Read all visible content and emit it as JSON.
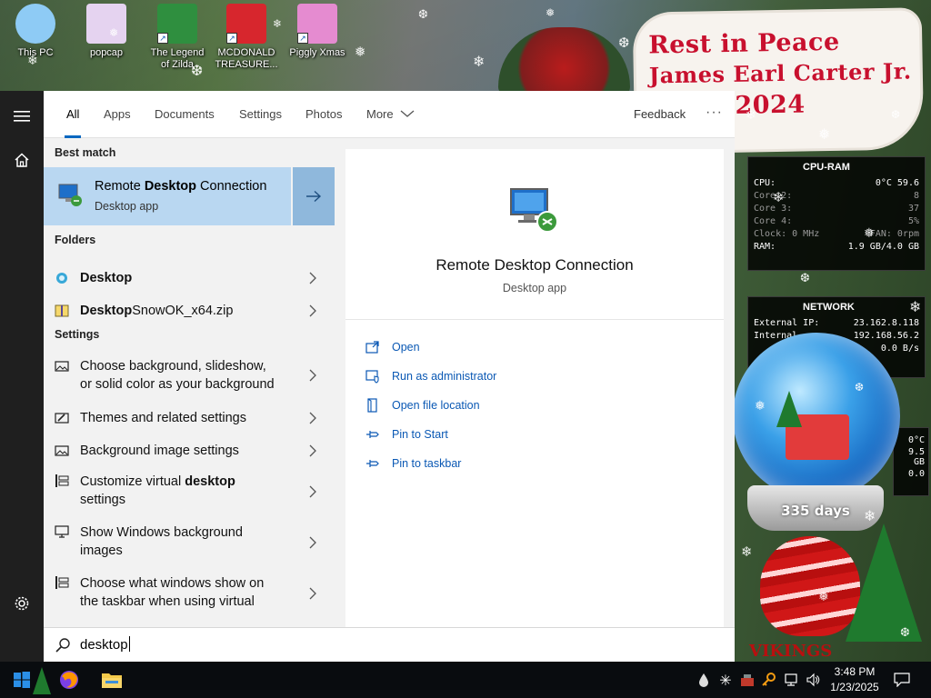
{
  "desktop": {
    "icons": [
      {
        "label": "This PC",
        "color": "#8ecbf5"
      },
      {
        "label": "popcap",
        "color": "#e5d3f0"
      },
      {
        "label": "The Legend of Zilda",
        "color": "#2f8f3f"
      },
      {
        "label": "MCDONALD TREASURE...",
        "color": "#d7262d"
      },
      {
        "label": "Piggly Xmas",
        "color": "#e58bd0"
      }
    ],
    "note_lines": [
      "Rest in Peace",
      "James Earl Carter Jr.",
      "2024"
    ],
    "gadget_cpu": {
      "title": "CPU-RAM",
      "rows": [
        {
          "k": "CPU:",
          "v": "0°C      59.6"
        },
        {
          "k": "Core 2:",
          "v": "8"
        },
        {
          "k": "Core 3:",
          "v": "37"
        },
        {
          "k": "Core 4:",
          "v": "5%"
        },
        {
          "k": "Clock: 0 MHz",
          "v": "FAN: 0rpm"
        },
        {
          "k": "RAM:",
          "v": "1.9 GB/4.0 GB"
        }
      ]
    },
    "gadget_net": {
      "title": "NETWORK",
      "rows": [
        {
          "k": "External IP:",
          "v": "23.162.8.118"
        },
        {
          "k": "Internal",
          "v": "192.168.56.2"
        },
        {
          "k": "",
          "v": "0.0 B/s"
        }
      ]
    },
    "gadget_extra": {
      "temp": "0°C",
      "size": "9.5 GB",
      "small": "0.0"
    },
    "globe_days": "335 days",
    "vikings": "VIKINGS"
  },
  "rail": {
    "menu_icon": "hamburger-icon",
    "home_icon": "home-icon",
    "settings_icon": "gear-icon"
  },
  "tabs": {
    "all": "All",
    "apps": "Apps",
    "documents": "Documents",
    "settings": "Settings",
    "photos": "Photos",
    "more": "More",
    "feedback": "Feedback",
    "more_options": "···"
  },
  "results": {
    "best_match_header": "Best match",
    "best_match": {
      "pre": "Remote ",
      "bold": "Desktop",
      "post": " Connection",
      "sub": "Desktop app"
    },
    "folders_header": "Folders",
    "folders": [
      {
        "bold": "Desktop",
        "post": ""
      },
      {
        "bold": "Desktop",
        "post": "SnowOK_x64.zip"
      }
    ],
    "settings_header": "Settings",
    "settings": [
      {
        "line1": "Choose background, slideshow,",
        "line2": "or solid color as your background"
      },
      {
        "line1": "Themes and related settings",
        "line2": ""
      },
      {
        "line1": "Background image settings",
        "line2": ""
      },
      {
        "line1_pre": "Customize virtual ",
        "line1_bold": "desktop",
        "line2": "settings"
      },
      {
        "line1": "Show Windows background",
        "line2": "images"
      },
      {
        "line1": "Choose what windows show on",
        "line2": "the taskbar when using virtual"
      }
    ]
  },
  "detail": {
    "title": "Remote Desktop Connection",
    "subtitle": "Desktop app",
    "actions": [
      {
        "label": "Open",
        "icon": "open-icon"
      },
      {
        "label": "Run as administrator",
        "icon": "shield-icon"
      },
      {
        "label": "Open file location",
        "icon": "file-location-icon"
      },
      {
        "label": "Pin to Start",
        "icon": "pin-icon"
      },
      {
        "label": "Pin to taskbar",
        "icon": "pin-icon"
      }
    ]
  },
  "search": {
    "value": "desktop",
    "icon": "search-icon"
  },
  "taskbar": {
    "time": "3:48 PM",
    "date": "1/23/2025",
    "accent": "#0078d7"
  }
}
